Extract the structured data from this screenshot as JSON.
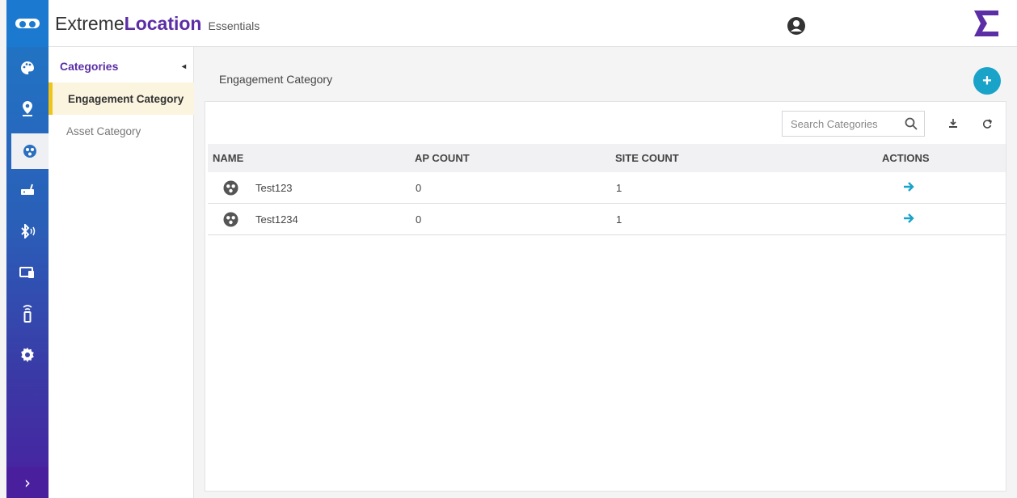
{
  "header": {
    "brand_part1": "Extreme",
    "brand_part2": "Location",
    "brand_part3": "Essentials",
    "user_icon": "user-circle-icon",
    "logo_icon": "extreme-e-logo"
  },
  "rail": {
    "items": [
      "palette-icon",
      "location-pin-icon",
      "category-icon",
      "router-icon",
      "bluetooth-icon",
      "devices-icon",
      "beacon-icon",
      "gear-icon"
    ],
    "active": "category-icon",
    "expand_label": "›"
  },
  "subnav": {
    "heading": "Categories",
    "caret": "◂",
    "items": [
      {
        "label": "Engagement Category",
        "selected": true
      },
      {
        "label": "Asset Category",
        "selected": false
      }
    ]
  },
  "main": {
    "title": "Engagement Category",
    "add_label": "+",
    "search_placeholder": "Search Categories",
    "columns": {
      "name": "NAME",
      "ap_count": "AP COUNT",
      "site_count": "SITE COUNT",
      "actions": "ACTIONS"
    },
    "rows": [
      {
        "name": "Test123",
        "ap_count": "0",
        "site_count": "1"
      },
      {
        "name": "Test1234",
        "ap_count": "0",
        "site_count": "1"
      }
    ]
  },
  "colors": {
    "accent": "#1aa3c9",
    "brand_purple": "#5b2ea6",
    "selected_bar": "#f0c419"
  }
}
